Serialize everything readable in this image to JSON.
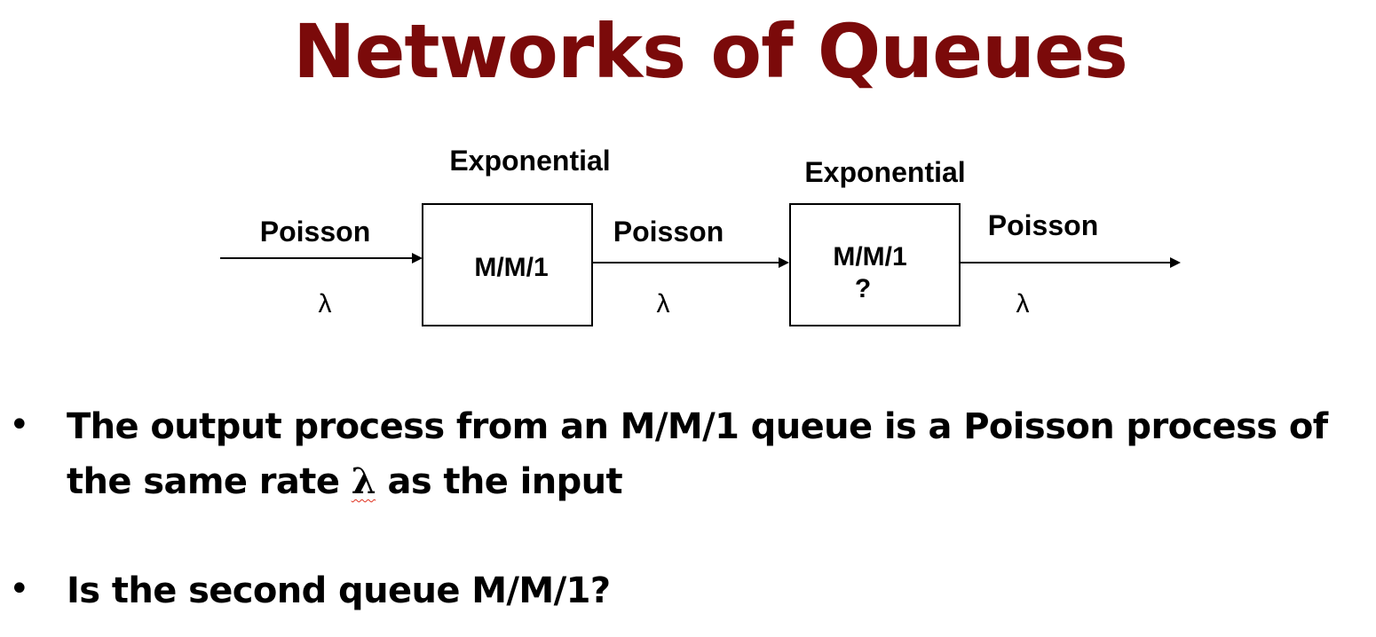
{
  "title": "Networks of Queues",
  "colors": {
    "title": "#7b0a0a",
    "text": "#000000",
    "spell_underline": "#e0301e"
  },
  "diagram": {
    "input_label": "Poisson",
    "input_rate": "λ",
    "queue1": {
      "service_label": "Exponential",
      "name": "M/M/1"
    },
    "middle_label": "Poisson",
    "middle_rate": "λ",
    "queue2": {
      "service_label": "Exponential",
      "name": "M/M/1",
      "question": "?"
    },
    "output_label": "Poisson",
    "output_rate": "λ"
  },
  "bullets": {
    "item1_before": "The output process from an M/M/1 queue is a Poisson process of the same rate ",
    "item1_lambda": "λ",
    "item1_after": " as the input",
    "item2": "Is the second queue M/M/1?",
    "marker": "•"
  }
}
